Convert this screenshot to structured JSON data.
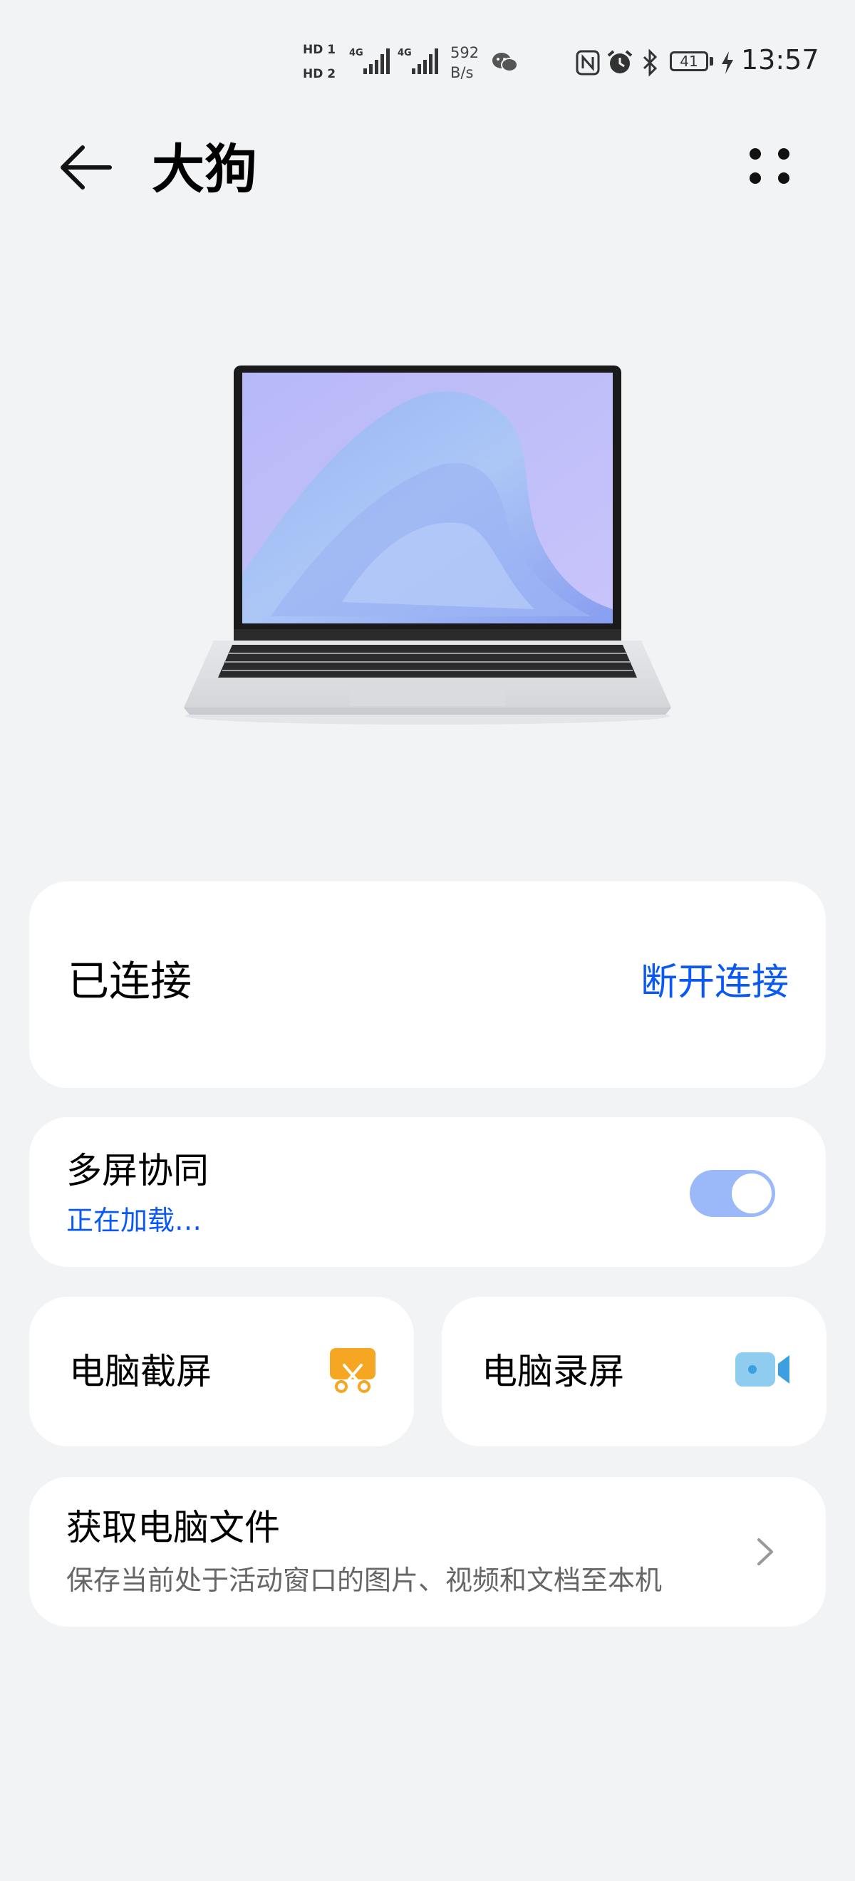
{
  "status_bar": {
    "sim1": "HD 1",
    "sim2": "HD 2",
    "net_type_1": "4G",
    "net_type_2": "4G",
    "net_speed_value": "592",
    "net_speed_unit": "B/s",
    "battery": "41",
    "time": "13:57"
  },
  "header": {
    "title": "大狗"
  },
  "connection": {
    "status": "已连接",
    "disconnect": "断开连接"
  },
  "multiscreen": {
    "title": "多屏协同",
    "status": "正在加载…",
    "toggle_on": true
  },
  "actions": {
    "screenshot_label": "电脑截屏",
    "record_label": "电脑录屏"
  },
  "files": {
    "title": "获取电脑文件",
    "subtitle": "保存当前处于活动窗口的图片、视频和文档至本机"
  },
  "colors": {
    "accent": "#0a59f7",
    "toggle_track": "#9bb8f9",
    "screenshot_icon": "#f5a623",
    "record_icon": "#8fcdf0",
    "background": "#f1f3f5"
  }
}
